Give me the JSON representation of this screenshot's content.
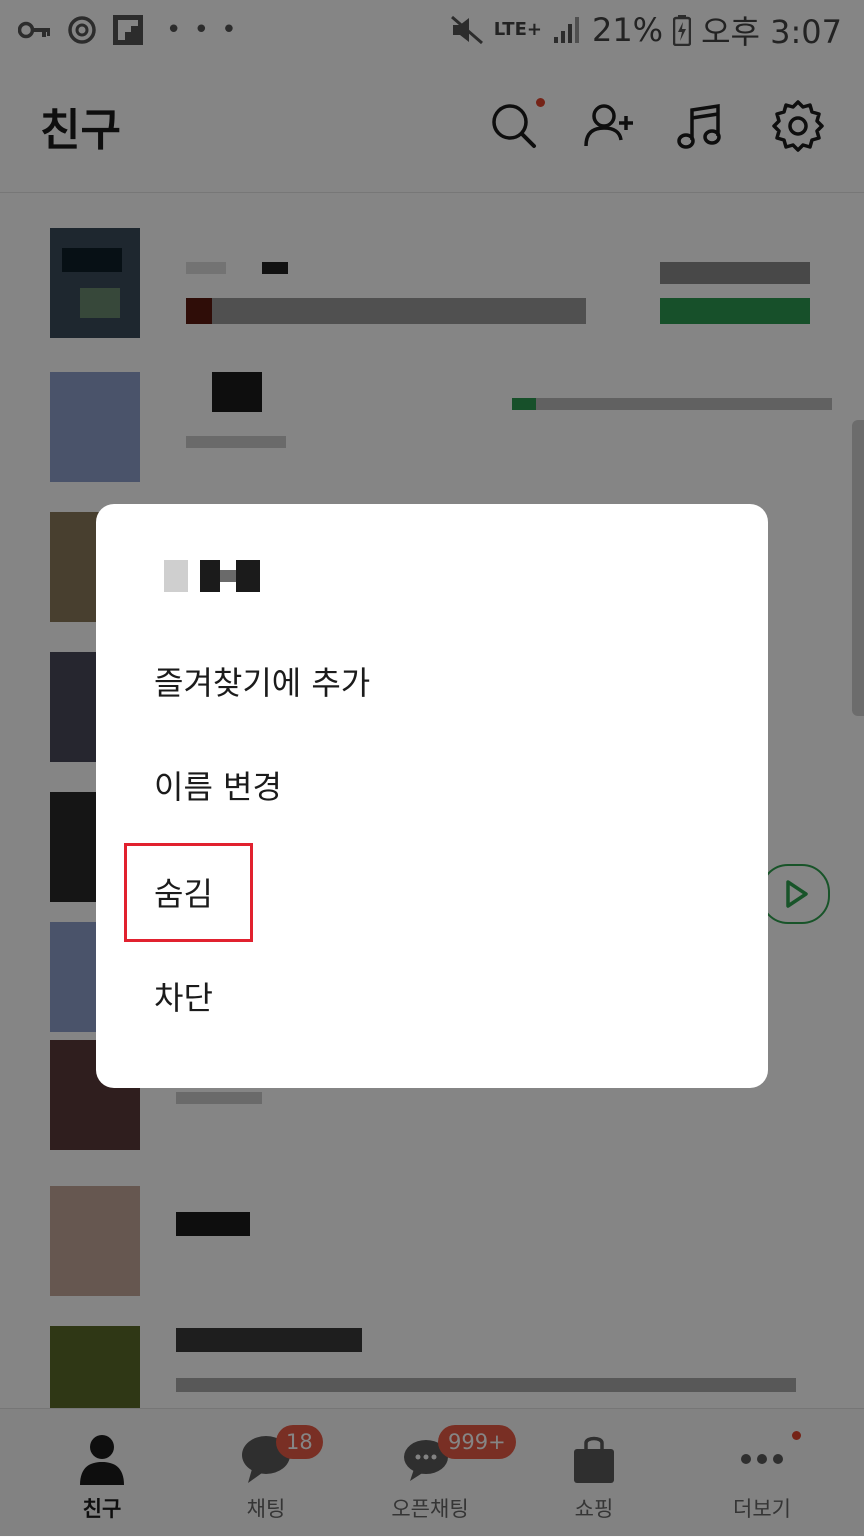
{
  "status_bar": {
    "battery": "21%",
    "network": "LTE+",
    "time": "오후 3:07"
  },
  "header": {
    "title": "친구",
    "icons": [
      "search-icon",
      "add-friend-icon",
      "music-icon",
      "settings-icon"
    ]
  },
  "context_menu": {
    "items": [
      "즐겨찾기에 추가",
      "이름 변경",
      "숨김",
      "차단"
    ],
    "highlighted_item": "숨김"
  },
  "bottom_nav": {
    "items": [
      {
        "label": "친구",
        "icon": "person-icon",
        "active": true
      },
      {
        "label": "채팅",
        "icon": "chat-bubble-icon",
        "badge": "18"
      },
      {
        "label": "오픈채팅",
        "icon": "open-chat-icon",
        "badge": "999+"
      },
      {
        "label": "쇼핑",
        "icon": "shopping-bag-icon"
      },
      {
        "label": "더보기",
        "icon": "more-icon"
      }
    ]
  },
  "colors": {
    "accent_green": "#2fa24f",
    "badge_red": "#e85a45",
    "highlight_red": "#e1212f",
    "overlay": "rgba(0,0,0,0.48)"
  }
}
